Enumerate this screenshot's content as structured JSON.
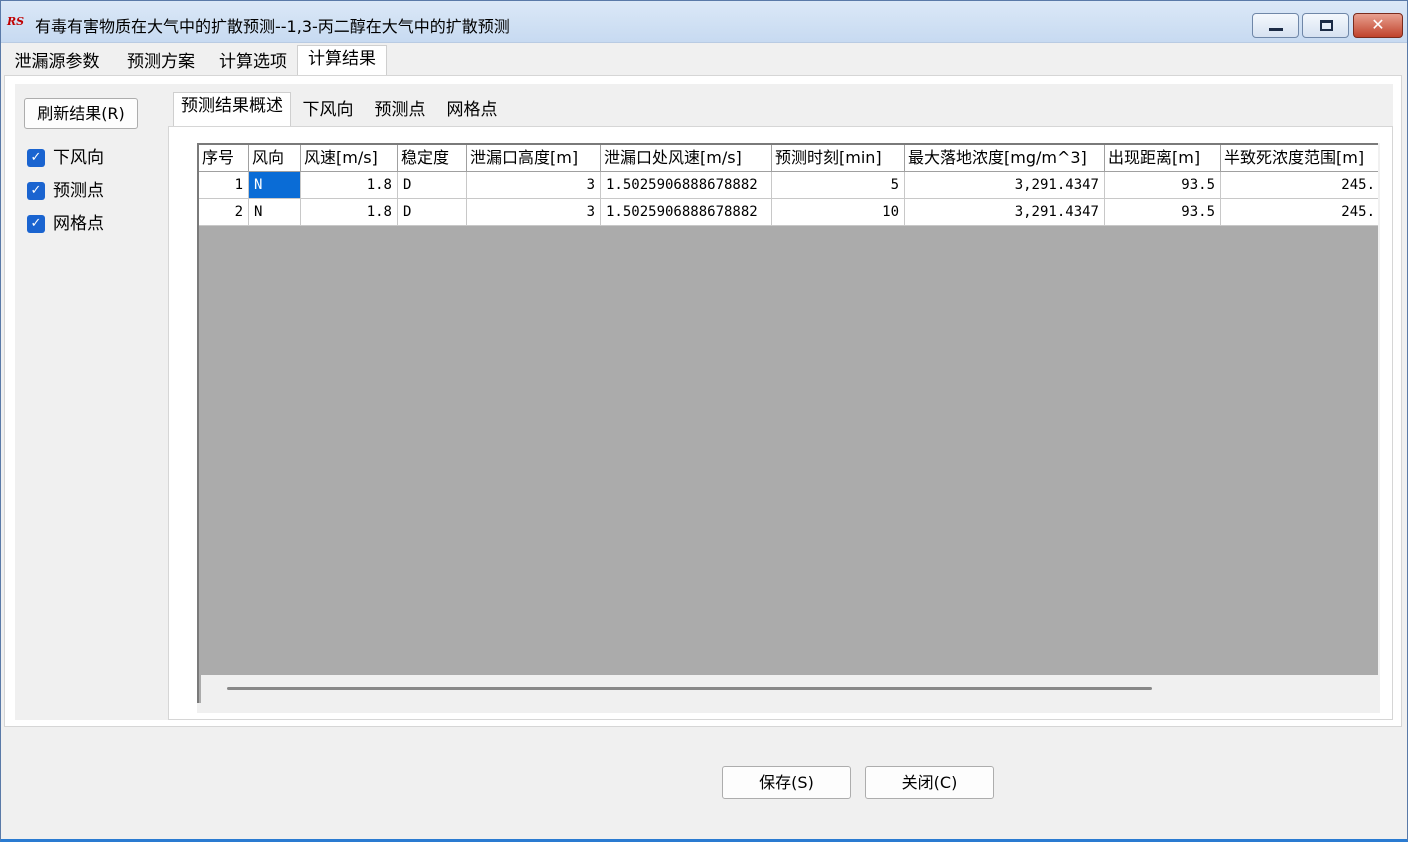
{
  "window": {
    "logo": "RS",
    "title": "有毒有害物质在大气中的扩散预测--1,3-丙二醇在大气中的扩散预测",
    "buttons": {
      "minimize": "minimize-icon",
      "maximize": "maximize-icon",
      "close": "✕"
    }
  },
  "main_tabs": [
    "泄漏源参数",
    "预测方案",
    "计算选项",
    "计算结果"
  ],
  "left": {
    "refresh_label": "刷新结果(R)",
    "checkboxes": [
      {
        "label": "下风向",
        "checked": true
      },
      {
        "label": "预测点",
        "checked": true
      },
      {
        "label": "网格点",
        "checked": true
      }
    ]
  },
  "inner_tabs": [
    "预测结果概述",
    "下风向",
    "预测点",
    "网格点"
  ],
  "table": {
    "headers": [
      "序号",
      "风向",
      "风速[m/s]",
      "稳定度",
      "泄漏口高度[m]",
      "泄漏口处风速[m/s]",
      "预测时刻[min]",
      "最大落地浓度[mg/m^3]",
      "出现距离[m]",
      "半致死浓度范围[m]"
    ],
    "rows": [
      [
        "1",
        "N",
        "1.8",
        "D",
        "3",
        "1.5025906888678882",
        "5",
        "3,291.4347",
        "93.5",
        "245."
      ],
      [
        "2",
        "N",
        "1.8",
        "D",
        "3",
        "1.5025906888678882",
        "10",
        "3,291.4347",
        "93.5",
        "245."
      ]
    ],
    "selected_cell": "N"
  },
  "footer": {
    "save_label": "保存(S)",
    "close_label": "关闭(C)"
  },
  "colors": {
    "selection": "#0a6cd6",
    "grid_empty": "#ababab",
    "checkbox": "#1a64d0"
  }
}
